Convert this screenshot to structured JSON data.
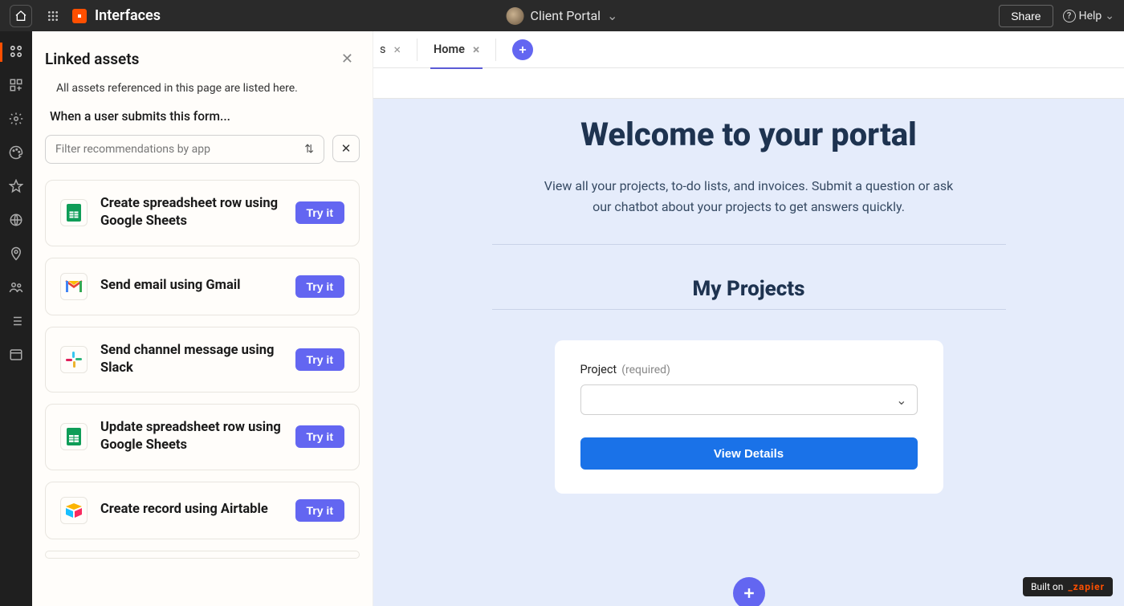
{
  "topbar": {
    "title": "Interfaces",
    "project": "Client Portal",
    "share": "Share",
    "help": "Help"
  },
  "panel": {
    "title": "Linked assets",
    "subtitle": "All assets referenced in this page are listed here.",
    "form_trigger": "When a user submits this form...",
    "filter_placeholder": "Filter recommendations by app",
    "try_label": "Try it",
    "items": [
      {
        "title": "Create spreadsheet row using Google Sheets",
        "icon": "sheets"
      },
      {
        "title": "Send email using Gmail",
        "icon": "gmail"
      },
      {
        "title": "Send channel message using Slack",
        "icon": "slack"
      },
      {
        "title": "Update spreadsheet row using Google Sheets",
        "icon": "sheets"
      },
      {
        "title": "Create record using Airtable",
        "icon": "airtable"
      }
    ]
  },
  "tabs": {
    "partial": "s",
    "active": "Home"
  },
  "canvas": {
    "hero_title": "Welcome to your portal",
    "hero_sub": "View all your projects, to-do lists, and invoices. Submit a question or ask our chatbot about your projects to get answers quickly.",
    "section_title": "My Projects",
    "form": {
      "label": "Project",
      "required": "(required)",
      "button": "View Details"
    }
  },
  "badge": {
    "prefix": "Built on",
    "brand": "_zapier"
  }
}
